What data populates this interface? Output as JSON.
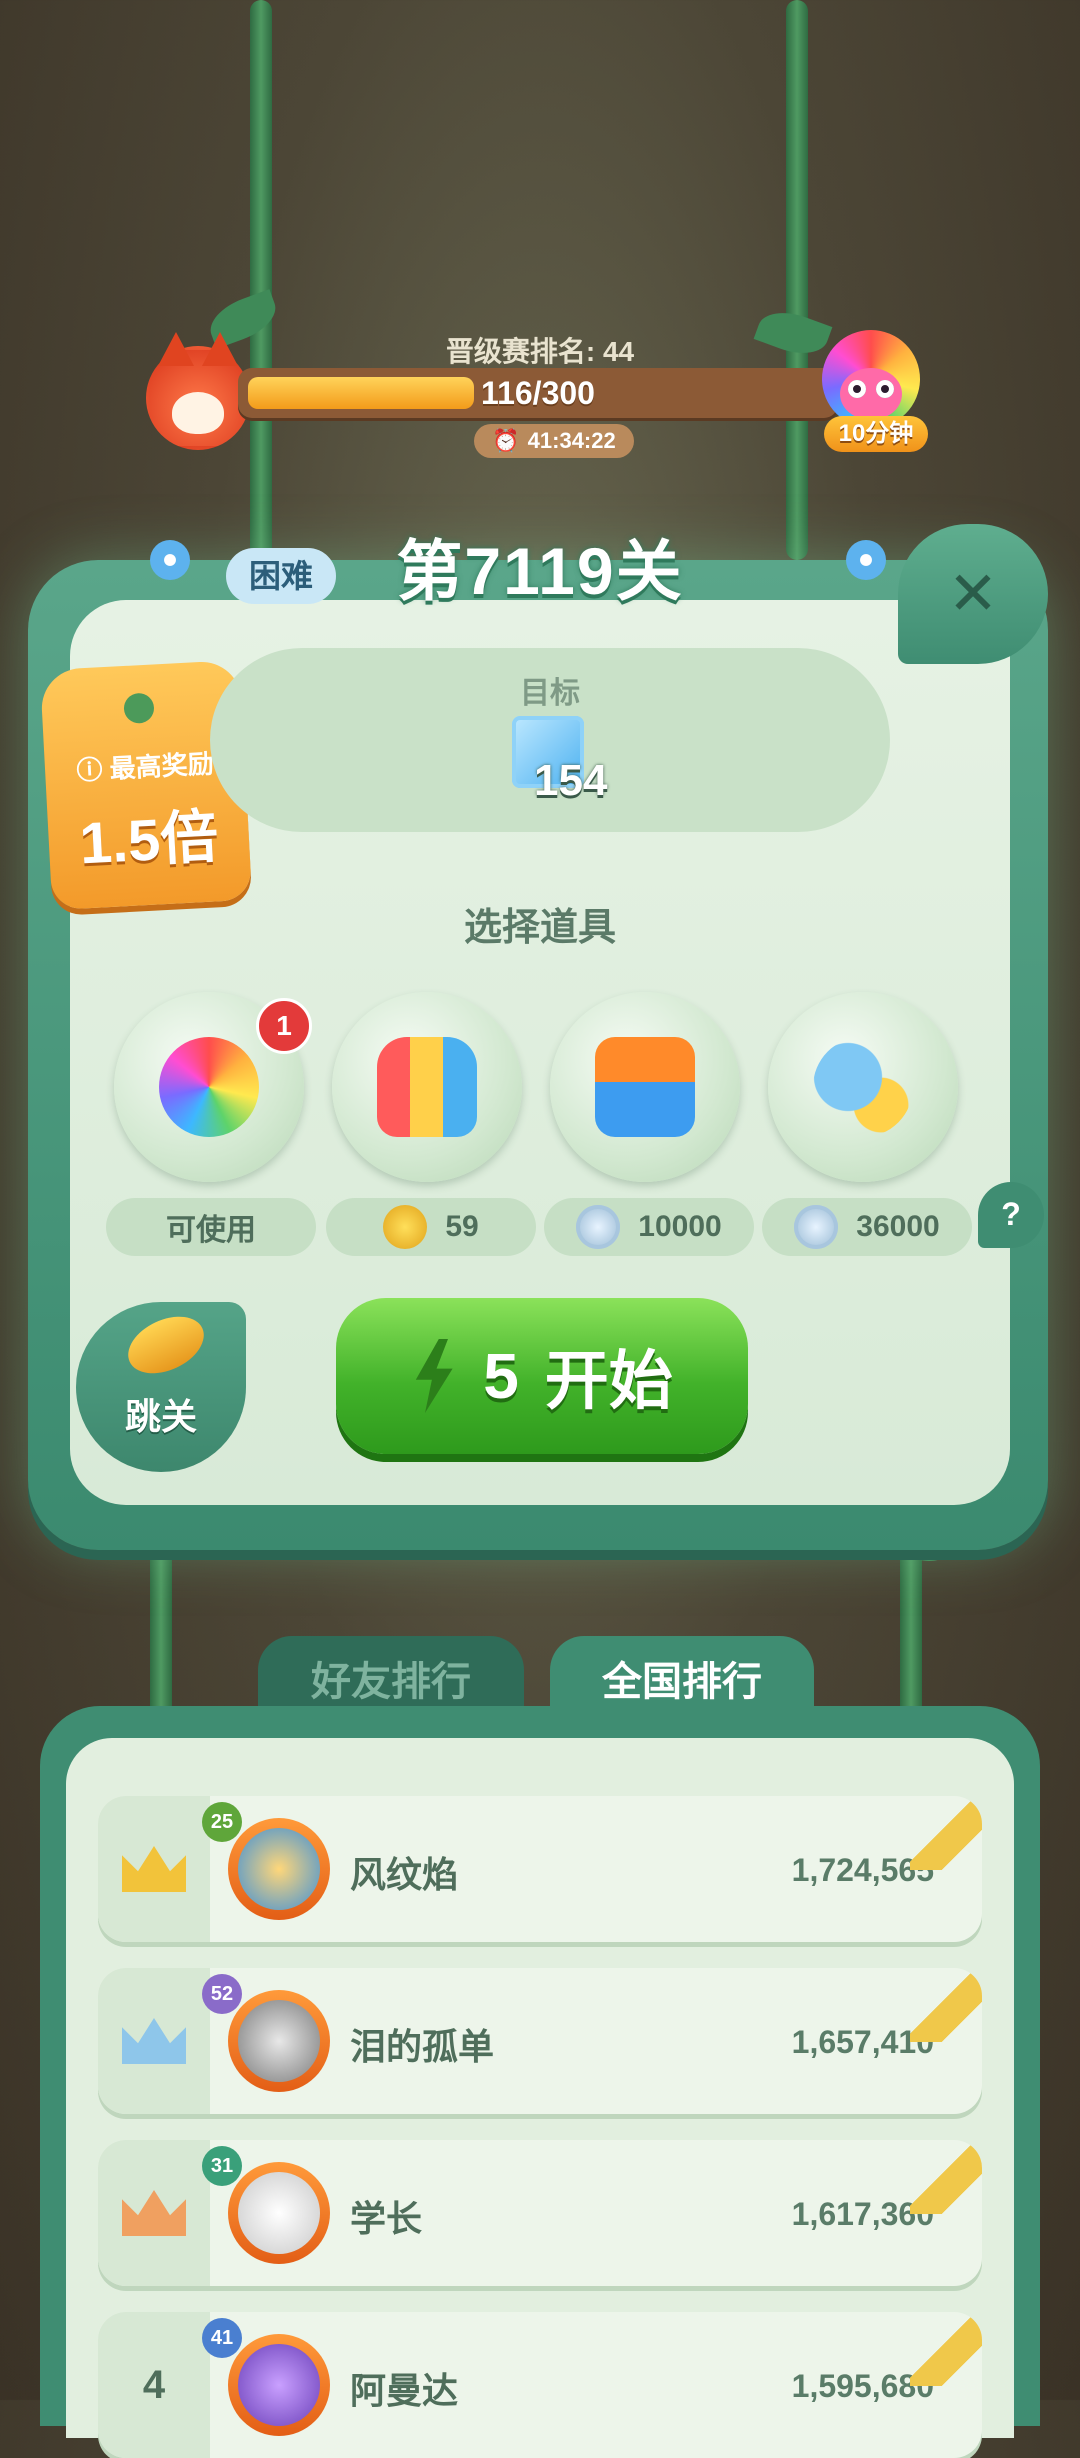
{
  "top": {
    "rank_label": "晋级赛排名: 44",
    "progress_text": "116/300",
    "progress_fraction": 0.387,
    "timer": "41:34:22",
    "reward_badge": "10分钟"
  },
  "level": {
    "title": "第7119关",
    "difficulty": "困难",
    "reward_label": "最高奖励",
    "reward_value": "1.5倍",
    "target_label": "目标",
    "target_count": "154"
  },
  "boosters": {
    "title": "选择道具",
    "items": [
      {
        "name": "rainbow-owl",
        "badge": "1",
        "price": "可使用",
        "currency": "none"
      },
      {
        "name": "rockets",
        "price": "59",
        "currency": "gold-coin"
      },
      {
        "name": "plus-three-moves",
        "price": "10000",
        "currency": "silver-coin"
      },
      {
        "name": "hippo-chick",
        "price": "36000",
        "currency": "silver-coin"
      }
    ]
  },
  "actions": {
    "skip_label": "跳关",
    "start_cost": "5",
    "start_label": "开始"
  },
  "leaderboard": {
    "tabs": [
      "好友排行",
      "全国排行"
    ],
    "active_tab": "全国排行",
    "rows": [
      {
        "rank": "1",
        "level": "25",
        "name": "风纹焰",
        "score": "1,724,565"
      },
      {
        "rank": "2",
        "level": "52",
        "name": "泪的孤单",
        "score": "1,657,410"
      },
      {
        "rank": "3",
        "level": "31",
        "name": "学长",
        "score": "1,617,360"
      },
      {
        "rank": "4",
        "level": "41",
        "name": "阿曼达",
        "score": "1,595,680"
      }
    ]
  },
  "colors": {
    "gold": "#f2c33a",
    "silver": "#8ec6ea",
    "bronze": "#f0a060",
    "start_green": "#42b22a"
  }
}
